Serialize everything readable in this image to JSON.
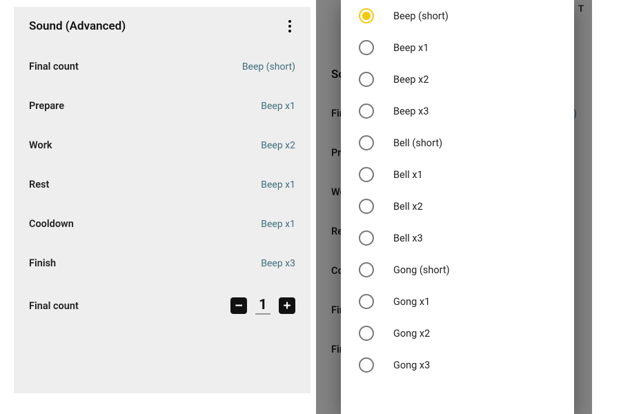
{
  "title": "Sound (Advanced)",
  "settings": [
    {
      "label": "Final count",
      "value": "Beep (short)"
    },
    {
      "label": "Prepare",
      "value": "Beep x1"
    },
    {
      "label": "Work",
      "value": "Beep x2"
    },
    {
      "label": "Rest",
      "value": "Beep x1"
    },
    {
      "label": "Cooldown",
      "value": "Beep x1"
    },
    {
      "label": "Finish",
      "value": "Beep x3"
    }
  ],
  "stepper": {
    "label": "Final count",
    "value": "1"
  },
  "bg": {
    "title_partial": "So",
    "rows": [
      "Fin",
      "Pre",
      "Wo",
      "Res",
      "Co",
      "Fin",
      "Fin"
    ],
    "top_right_partial": "T",
    "value_partial": ")"
  },
  "picker": {
    "options": [
      "Beep (short)",
      "Beep x1",
      "Beep x2",
      "Beep x3",
      "Bell (short)",
      "Bell x1",
      "Bell x2",
      "Bell x3",
      "Gong (short)",
      "Gong x1",
      "Gong x2",
      "Gong x3"
    ],
    "selected": "Beep (short)"
  },
  "stepper_glyphs": {
    "minus": "−",
    "plus": "+"
  }
}
